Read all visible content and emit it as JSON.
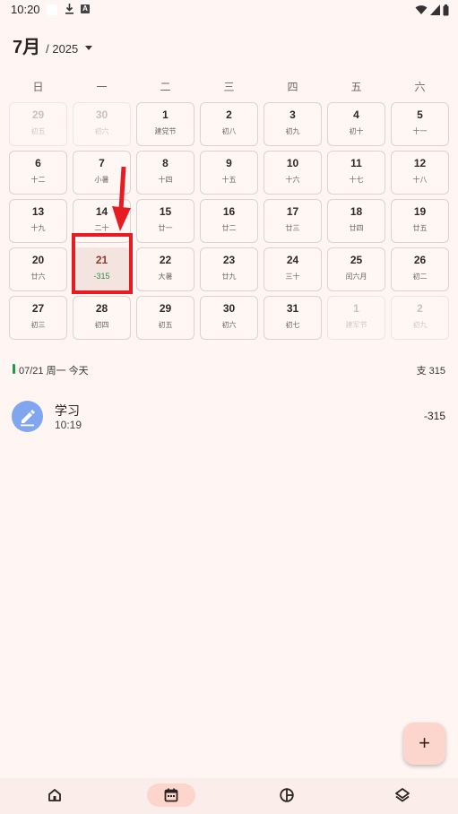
{
  "status_bar": {
    "time": "10:20"
  },
  "header": {
    "month": "7月",
    "year": "/ 2025"
  },
  "weekdays": [
    "日",
    "一",
    "二",
    "三",
    "四",
    "五",
    "六"
  ],
  "calendar": {
    "days": [
      {
        "num": "29",
        "sub": "初五",
        "outside": true
      },
      {
        "num": "30",
        "sub": "初六",
        "outside": true
      },
      {
        "num": "1",
        "sub": "建党节"
      },
      {
        "num": "2",
        "sub": "初八"
      },
      {
        "num": "3",
        "sub": "初九"
      },
      {
        "num": "4",
        "sub": "初十"
      },
      {
        "num": "5",
        "sub": "十一"
      },
      {
        "num": "6",
        "sub": "十二"
      },
      {
        "num": "7",
        "sub": "小暑"
      },
      {
        "num": "8",
        "sub": "十四"
      },
      {
        "num": "9",
        "sub": "十五"
      },
      {
        "num": "10",
        "sub": "十六"
      },
      {
        "num": "11",
        "sub": "十七"
      },
      {
        "num": "12",
        "sub": "十八"
      },
      {
        "num": "13",
        "sub": "十九"
      },
      {
        "num": "14",
        "sub": "二十"
      },
      {
        "num": "15",
        "sub": "廿一"
      },
      {
        "num": "16",
        "sub": "廿二"
      },
      {
        "num": "17",
        "sub": "廿三"
      },
      {
        "num": "18",
        "sub": "廿四"
      },
      {
        "num": "19",
        "sub": "廿五"
      },
      {
        "num": "20",
        "sub": "廿六"
      },
      {
        "num": "21",
        "sub": "-315",
        "today": true
      },
      {
        "num": "22",
        "sub": "大暑"
      },
      {
        "num": "23",
        "sub": "廿九"
      },
      {
        "num": "24",
        "sub": "三十"
      },
      {
        "num": "25",
        "sub": "闰六月"
      },
      {
        "num": "26",
        "sub": "初二"
      },
      {
        "num": "27",
        "sub": "初三"
      },
      {
        "num": "28",
        "sub": "初四"
      },
      {
        "num": "29",
        "sub": "初五"
      },
      {
        "num": "30",
        "sub": "初六"
      },
      {
        "num": "31",
        "sub": "初七"
      },
      {
        "num": "1",
        "sub": "建军节",
        "outside": true
      },
      {
        "num": "2",
        "sub": "初九",
        "outside": true
      }
    ]
  },
  "summary": {
    "date": "07/21 周一 今天",
    "total": "支 315",
    "bar_color": "#1f9a4a"
  },
  "records": [
    {
      "icon": "pencil-icon",
      "title": "学习",
      "time": "10:19",
      "amount": "-315"
    }
  ],
  "fab": {
    "label": "+"
  },
  "nav": [
    "home-icon",
    "calendar-icon",
    "chart-icon",
    "layers-icon"
  ],
  "colors": {
    "accent": "#fcd6cd",
    "highlight": "#e81b23",
    "income": "#2e8b4d"
  }
}
